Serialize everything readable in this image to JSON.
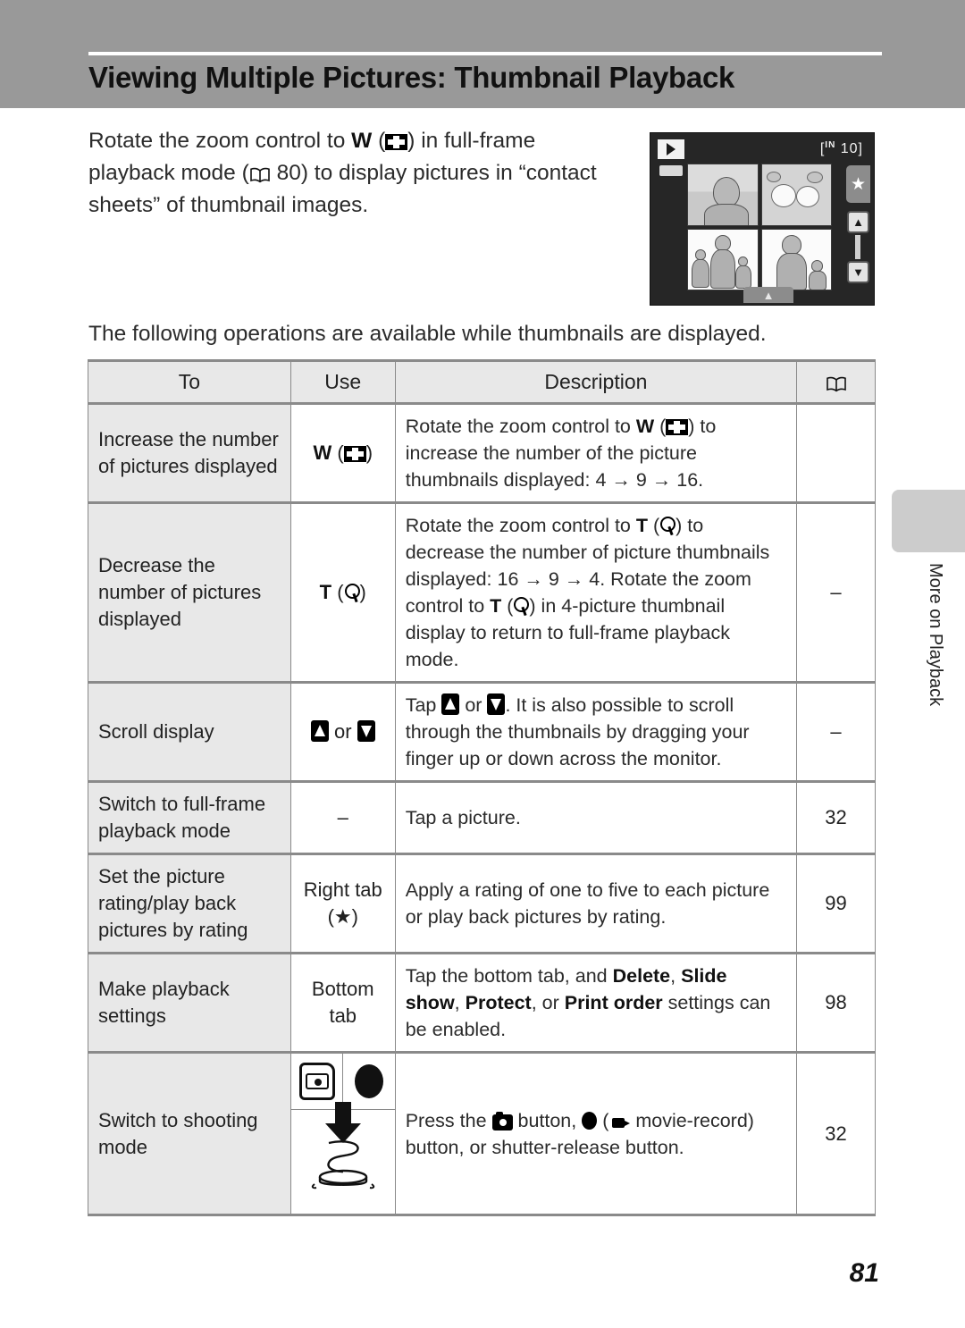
{
  "header": {
    "title": "Viewing Multiple Pictures: Thumbnail Playback",
    "band_color": "#999999"
  },
  "intro": {
    "line1_a": "Rotate the zoom control to ",
    "line1_w": "W",
    "line1_b": " (",
    "line1_c": ") in full-frame",
    "line2_a": "playback mode (",
    "line2_page": " 80) to display pictures in “contact",
    "line3": "sheets” of thumbnail images."
  },
  "monitor": {
    "playback_icon": "playback-icon",
    "battery_icon": "battery-icon",
    "counter_prefix": "[",
    "counter_memory": "IN",
    "counter_value": "10",
    "counter_suffix": "]",
    "star_tab": "★",
    "scroll_up": "▲",
    "scroll_down": "▼",
    "bottom_tab": "▲"
  },
  "leadin": "The following operations are available while thumbnails are displayed.",
  "table": {
    "headers": {
      "to": "To",
      "use": "Use",
      "description": "Description",
      "reference": "book-icon"
    },
    "rows": [
      {
        "to": "Increase the number of pictures displayed",
        "use_text": "W",
        "use_icon": "thumbnail-grid-icon",
        "desc_parts": {
          "a": "Rotate the zoom control to ",
          "bold": "W",
          "b": " (",
          "c": ") to increase the number of the picture thumbnails displayed: 4 → 9 → 16."
        },
        "ref": ""
      },
      {
        "to": "Decrease the number of pictures displayed",
        "use_text": "T",
        "use_icon": "magnifier-icon",
        "desc_parts": {
          "a": "Rotate the zoom control to ",
          "bold": "T",
          "b": " (",
          "c": ") to decrease the number of picture thumbnails displayed: 16 → 9 → 4. Rotate the zoom control to ",
          "bold2": "T",
          "d": " (",
          "e": ") in 4-picture thumbnail display to return to full-frame playback mode."
        },
        "ref": "–"
      },
      {
        "to": "Scroll display",
        "use_text": "or",
        "use_icon": "up-down-arrow-icons",
        "desc_parts": {
          "a": "Tap ",
          "b": " or ",
          "c": ". It is also possible to scroll through the thumbnails by dragging your finger up or down across the monitor."
        },
        "ref": "–"
      },
      {
        "to": "Switch to full-frame playback mode",
        "use_text": "–",
        "use_icon": "",
        "desc_parts": {
          "a": "Tap a picture."
        },
        "ref": "32"
      },
      {
        "to": "Set the picture rating/play back pictures by rating",
        "use_text": "Right tab",
        "use_icon": "star-icon",
        "use_icon_text": "(★)",
        "desc_parts": {
          "a": "Apply a rating of one to five to each picture or play back pictures by rating."
        },
        "ref": "99"
      },
      {
        "to": "Make playback settings",
        "use_text": "Bottom tab",
        "use_icon": "",
        "desc_parts": {
          "a": "Tap the bottom tab, and ",
          "bold1": "Delete",
          "b": ", ",
          "bold2": "Slide show",
          "c": ", ",
          "bold3": "Protect",
          "d": ", or ",
          "bold4": "Print order",
          "e": " settings can be enabled."
        },
        "ref": "98"
      },
      {
        "to": "Switch to shooting mode",
        "use_text": "",
        "use_icon": "camera-button-icon record-button-icon shutter-press-icon",
        "desc_parts": {
          "a": "Press the ",
          "b": " button, ",
          "c": " (",
          "d": " movie-record) button, or shutter-release button."
        },
        "ref": "32"
      }
    ]
  },
  "side_tab": {
    "label": "More on Playback",
    "color": "#cccccc"
  },
  "footer": {
    "page_number": "81"
  }
}
